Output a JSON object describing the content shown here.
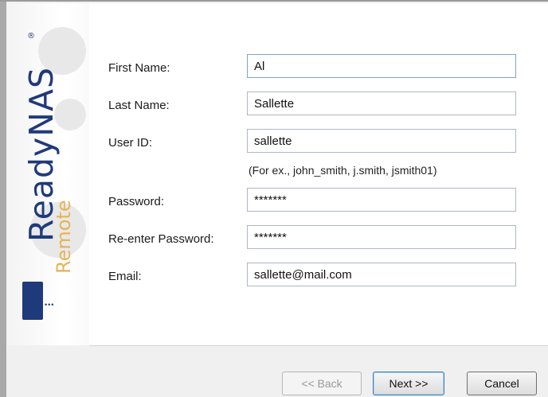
{
  "sidebar": {
    "logo_brand": "ReadyNAS",
    "logo_registered": "®",
    "logo_sub": "Remote",
    "logo_dots": "•••"
  },
  "form": {
    "first_name": {
      "label": "First Name:",
      "value": "Al"
    },
    "last_name": {
      "label": "Last Name:",
      "value": "Sallette"
    },
    "user_id": {
      "label": "User ID:",
      "value": "sallette",
      "hint": "(For ex., john_smith, j.smith, jsmith01)"
    },
    "password": {
      "label": "Password:",
      "value": "*******"
    },
    "reenter_password": {
      "label": "Re-enter Password:",
      "value": "*******"
    },
    "email": {
      "label": "Email:",
      "value": "sallette@mail.com"
    }
  },
  "buttons": {
    "back": "<< Back",
    "next": "Next >>",
    "cancel": "Cancel"
  },
  "colors": {
    "brand_blue": "#1f3a7a",
    "remote_orange": "#e5b458"
  }
}
